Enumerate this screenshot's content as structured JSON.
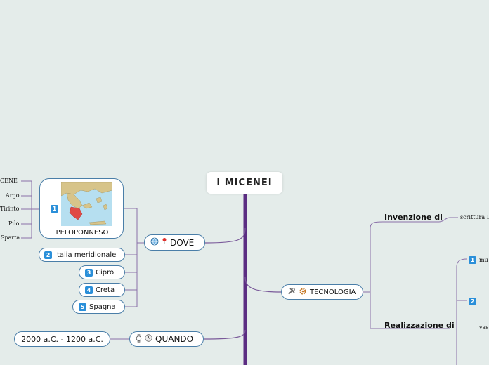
{
  "root": {
    "title": "I  MICENEI"
  },
  "dove": {
    "label": "DOVE",
    "peloponneso": {
      "number": "1",
      "label": "PELOPONNESO",
      "cities": [
        "CENE",
        "Argo",
        "Tirinto",
        "Pilo",
        "Sparta"
      ]
    },
    "places": [
      {
        "number": "2",
        "label": "Italia meridionale"
      },
      {
        "number": "3",
        "label": "Cipro"
      },
      {
        "number": "4",
        "label": "Creta"
      },
      {
        "number": "5",
        "label": "Spagna"
      }
    ]
  },
  "quando": {
    "label": "QUANDO",
    "value": "2000 a.C. - 1200 a.C."
  },
  "tecnologia": {
    "label": "TECNOLOGIA",
    "invenzione": {
      "label": "Invenzione di",
      "leaf": "scrittura L"
    },
    "realizzazione": {
      "label": "Realizzazione di",
      "items": [
        {
          "number": "1",
          "text": "mu"
        },
        {
          "number": "2",
          "text": ""
        }
      ],
      "leaf": "vas"
    }
  },
  "colors": {
    "trunk": "#5b2d82",
    "connector": "#8a70a8",
    "node_border": "#4a7ea8",
    "badge": "#2a8fd9",
    "map_highlight": "#e04a45",
    "map_land": "#d7c48a",
    "map_sea": "#b6dff0"
  },
  "icons": [
    "globe-icon",
    "pin-icon",
    "watch-icon",
    "clock-icon",
    "tools-icon",
    "gear-icon",
    "greece-map-image"
  ]
}
